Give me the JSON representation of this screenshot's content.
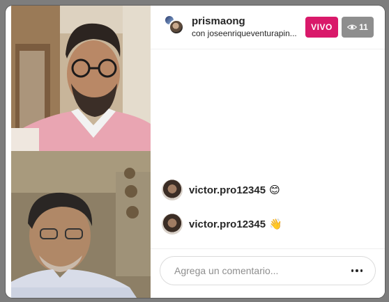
{
  "header": {
    "host_username": "prismaong",
    "subtitle": "con joseenriqueventurapin...",
    "live_label": "VIVO",
    "viewer_count": "11"
  },
  "comments": [
    {
      "username": "victor.pro12345",
      "emoji": "😊"
    },
    {
      "username": "victor.pro12345",
      "emoji": "👋"
    }
  ],
  "comment_input": {
    "placeholder": "Agrega un comentario..."
  },
  "icons": {
    "viewers": "eye-icon",
    "more": "more-options-icon"
  },
  "colors": {
    "live_badge": "#d9196a",
    "viewers_badge": "#8e8e8e"
  }
}
